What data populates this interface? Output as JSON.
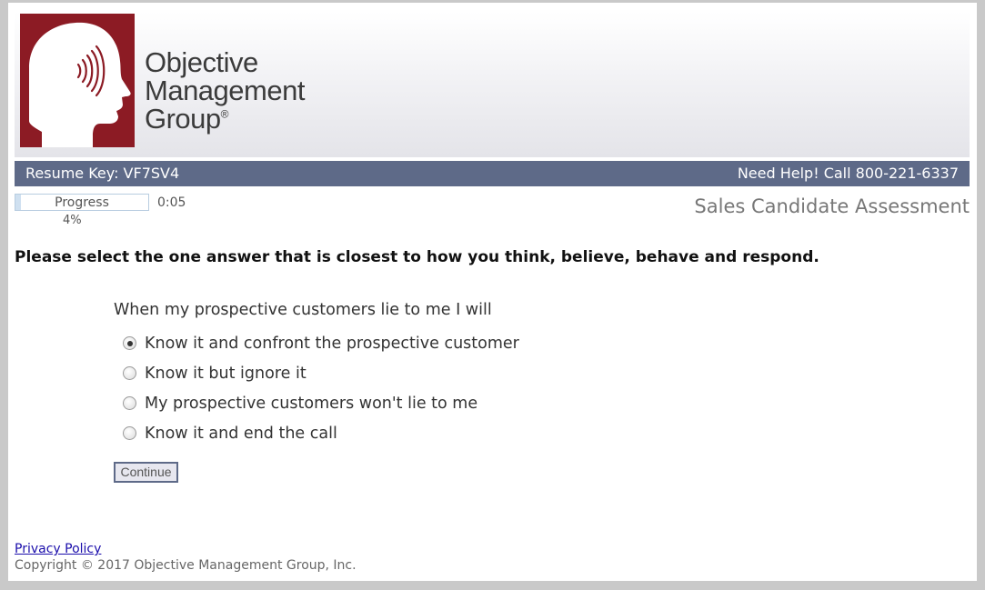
{
  "logo": {
    "line1": "Objective",
    "line2": "Management",
    "line3": "Group",
    "registered": "®",
    "brand_color": "#8c1b24"
  },
  "header_bar": {
    "resume_key": "Resume Key: VF7SV4",
    "help": "Need Help! Call 800-221-6337",
    "color": "#5e6a88"
  },
  "progress": {
    "label": "Progress",
    "percent_text": "4%",
    "value": 0.04,
    "timer": "0:05"
  },
  "assessment_title": "Sales Candidate Assessment",
  "instruction": "Please select the one answer that is closest to how you think, believe, behave and respond.",
  "question": {
    "text": "When my prospective customers lie to me I will",
    "options": [
      {
        "label": "Know it and confront the prospective customer",
        "selected": true
      },
      {
        "label": "Know it but ignore it",
        "selected": false
      },
      {
        "label": "My prospective customers won't lie to me",
        "selected": false
      },
      {
        "label": "Know it and end the call",
        "selected": false
      }
    ]
  },
  "continue_label": "Continue",
  "footer": {
    "privacy": "Privacy Policy",
    "copyright": "Copyright © 2017 Objective Management Group, Inc."
  }
}
